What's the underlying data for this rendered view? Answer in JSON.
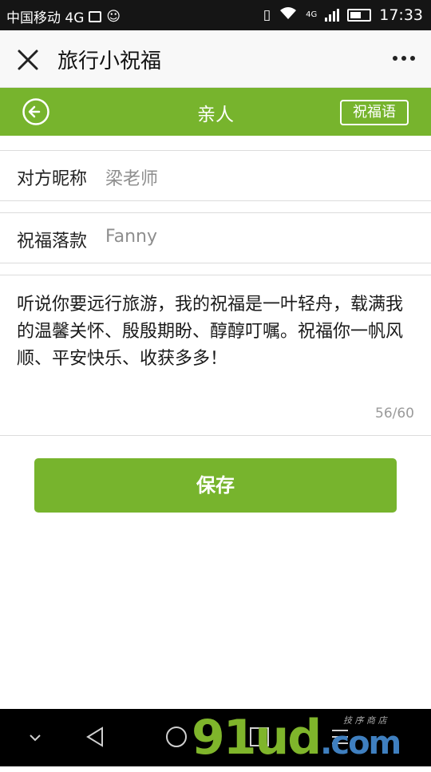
{
  "status_bar": {
    "carrier": "中国移动 4G",
    "network": "4G",
    "time": "17:33"
  },
  "header": {
    "title": "旅行小祝福",
    "close_icon": "close-icon",
    "more_icon": "more-icon"
  },
  "green_bar": {
    "title": "亲人",
    "tag_button": "祝福语",
    "back_icon": "back-arrow-circle-icon"
  },
  "fields": {
    "nickname": {
      "label": "对方昵称",
      "value": "梁老师"
    },
    "signature": {
      "label": "祝福落款",
      "value": "Fanny"
    }
  },
  "message": {
    "text": "听说你要远行旅游，我的祝福是一叶轻舟，载满我的温馨关怀、殷殷期盼、醇醇叮嘱。祝福你一帆风顺、平安快乐、收获多多！",
    "counter": "56/60"
  },
  "save_button": {
    "label": "保存"
  },
  "watermark": {
    "brand": "91ud",
    "domain": ".com",
    "tagline": "技 序 商 店"
  },
  "colors": {
    "accent": "#77b42d",
    "status_bar": "#151515",
    "nav_bar": "#000000"
  }
}
